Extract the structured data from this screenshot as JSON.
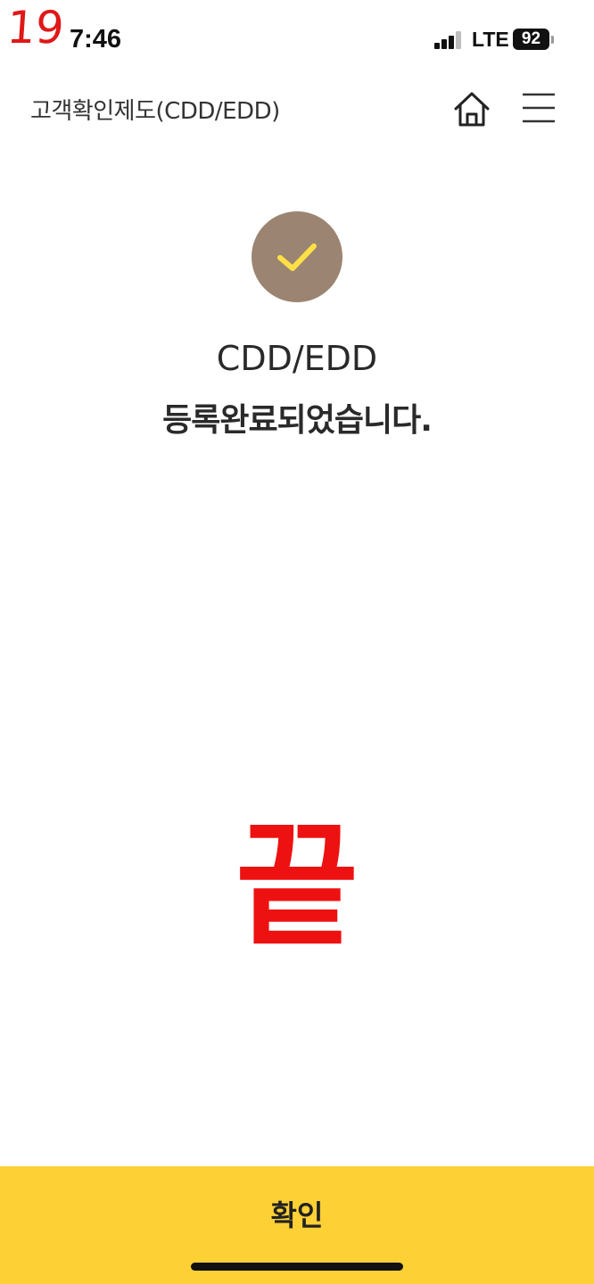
{
  "annotation": {
    "step_number": "19",
    "end_mark": "끝",
    "color": "#ee1111"
  },
  "status_bar": {
    "time": "7:46",
    "network": "LTE",
    "battery": "92"
  },
  "header": {
    "title": "고객확인제도(CDD/EDD)",
    "icons": [
      "home-icon",
      "hamburger-menu-icon"
    ]
  },
  "result": {
    "icon": "checkmark-icon",
    "line1": "CDD/EDD",
    "line2": "등록완료되었습니다.",
    "circle_color": "#9b8471",
    "check_color": "#fde047"
  },
  "footer": {
    "confirm_label": "확인",
    "button_color": "#fdd035"
  }
}
